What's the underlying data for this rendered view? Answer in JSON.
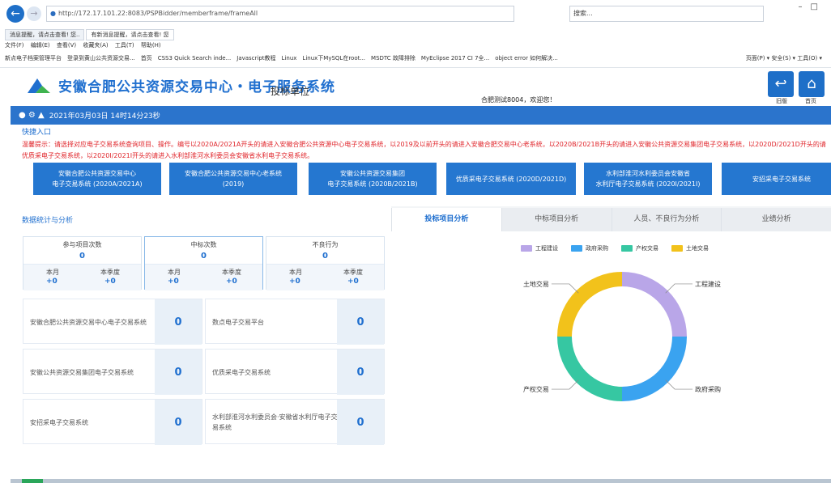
{
  "browser": {
    "url": "http://172.17.101.22:8083/PSPBidder/memberframe/frameAll",
    "search": "搜索...",
    "tabs": [
      "消息提醒，请点击查看! 您..",
      "有新消息提醒，请点击查看! 您"
    ],
    "menu": [
      "文件(F)",
      "编辑(E)",
      "查看(V)",
      "收藏夹(A)",
      "工具(T)",
      "帮助(H)"
    ],
    "favorites": [
      "新点电子档案管理平台",
      "登录到黄山公共资源交易...",
      "首页",
      "CSS3 Quick Search inde...",
      "Javascript教程",
      "Linux",
      "Linux下MySQL在root...",
      "MSDTC 故障排除",
      "MyEclipse 2017 CI 7全...",
      "object error 如何解决..."
    ],
    "favorites_right": "页面(P) ▾  安全(S) ▾  工具(O) ▾"
  },
  "header": {
    "site_name": "安徽合肥公共资源交易中心・电子服务系统",
    "unit": "投标单位",
    "welcome": "合肥测试8004，欢迎您！",
    "old_label": "旧版",
    "home_label": "首页"
  },
  "bar": {
    "datetime": "2021年03月03日 14时14分23秒"
  },
  "quick": {
    "title": "快捷入口",
    "notice1": "温馨提示：请选择对应电子交易系统查询项目、操作。编号以2020A/2021A开头的请进入安徽合肥公共资源中心电子交易系统，以2019及以前开头的请进入安徽合肥交易中心老系统，以2020B/2021B开头的请进入安徽公共资源交易集团电子交易系统，以2020D/2021D开头的请",
    "notice2": "优质采电子交易系统，以2020I/2021I开头的请进入水利部淮河水利委员会安徽省水利电子交易系统。",
    "systems": [
      {
        "line1": "安徽合肥公共资源交易中心",
        "line2": "电子交易系统 (2020A/2021A)"
      },
      {
        "line1": "安徽合肥公共资源交易中心老系统",
        "line2": "(2019)"
      },
      {
        "line1": "安徽公共资源交易集团",
        "line2": "电子交易系统 (2020B/2021B)"
      },
      {
        "line1": "优质采电子交易系统 (2020D/2021D)",
        "line2": ""
      },
      {
        "line1": "水利部淮河水利委员会安徽省",
        "line2": "水利厅电子交易系统 (2020I/2021I)"
      },
      {
        "line1": "安招采电子交易系统",
        "line2": ""
      }
    ]
  },
  "stats": {
    "title": "数据统计与分析",
    "cards": [
      {
        "title": "参与项目次数",
        "value": "0",
        "month_label": "本月",
        "month_value": "+0",
        "quarter_label": "本季度",
        "quarter_value": "+0"
      },
      {
        "title": "中标次数",
        "value": "0",
        "month_label": "本月",
        "month_value": "+0",
        "quarter_label": "本季度",
        "quarter_value": "+0"
      },
      {
        "title": "不良行为",
        "value": "0",
        "month_label": "本月",
        "month_value": "+0",
        "quarter_label": "本季度",
        "quarter_value": "+0"
      }
    ],
    "platforms": [
      {
        "name": "安徽合肥公共资源交易中心电子交易系统",
        "count": "0"
      },
      {
        "name": "数点电子交易平台",
        "count": "0"
      },
      {
        "name": "安徽公共资源交易集团电子交易系统",
        "count": "0"
      },
      {
        "name": "优质采电子交易系统",
        "count": "0"
      },
      {
        "name": "安招采电子交易系统",
        "count": "0"
      },
      {
        "name": "水利部淮河水利委员会·安徽省水利厅电子交易系统",
        "count": "0"
      }
    ]
  },
  "analysis_tabs": [
    "投标项目分析",
    "中标项目分析",
    "人员、不良行为分析",
    "业绩分析"
  ],
  "chart_data": {
    "type": "pie",
    "categories": [
      "工程建设",
      "政府采购",
      "产权交易",
      "土地交易"
    ],
    "values": [
      25,
      25,
      25,
      25
    ],
    "colors": [
      "#b9a6e8",
      "#3aa3f0",
      "#36c7a2",
      "#f2c21b"
    ],
    "legend_position": "top"
  }
}
